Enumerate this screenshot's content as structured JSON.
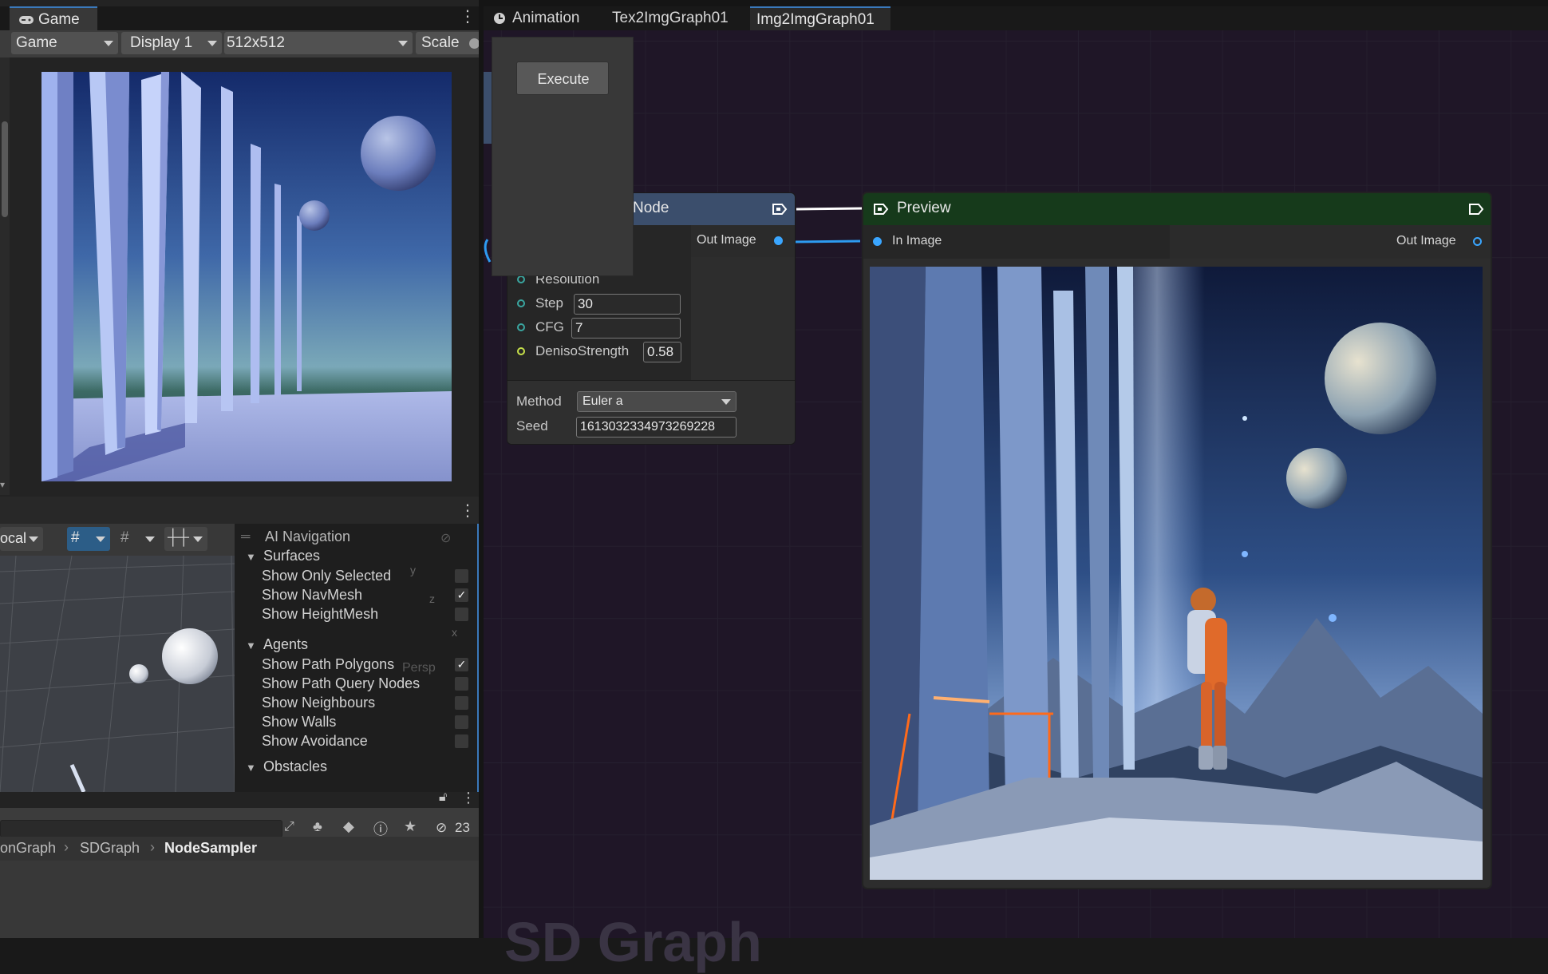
{
  "game_panel": {
    "tab_label": "Game",
    "view_select": "Game",
    "display_select": "Display 1",
    "resolution_select": "512x512",
    "scale_label": "Scale"
  },
  "editor_tabs": [
    {
      "label": "Animation"
    },
    {
      "label": "Tex2ImgGraph01"
    },
    {
      "label": "Img2ImgGraph01"
    }
  ],
  "execute_panel": {
    "execute_label": "Execute"
  },
  "sampler_node": {
    "title": "Node",
    "out_label": "Out Image",
    "fields": {
      "resolution_label": "Resolution",
      "step_label": "Step",
      "step_value": "30",
      "cfg_label": "CFG",
      "cfg_value": "7",
      "denoise_label": "DenisoStrength",
      "denoise_value": "0.58",
      "method_label": "Method",
      "method_value": "Euler a",
      "seed_label": "Seed",
      "seed_value": "1613032334973269228"
    }
  },
  "preview_node": {
    "title": "Preview",
    "in_label": "In Image",
    "out_label": "Out Image"
  },
  "scene_toolbar": {
    "pivot_select": "ocal"
  },
  "ai_navigation": {
    "title": "AI Navigation",
    "sections": [
      {
        "name": "Surfaces",
        "items": [
          {
            "label": "Show Only Selected",
            "checked": false
          },
          {
            "label": "Show NavMesh",
            "checked": true
          },
          {
            "label": "Show HeightMesh",
            "checked": false
          }
        ]
      },
      {
        "name": "Agents",
        "items": [
          {
            "label": "Show Path Polygons",
            "checked": true
          },
          {
            "label": "Show Path Query Nodes",
            "checked": false
          },
          {
            "label": "Show Neighbours",
            "checked": false
          },
          {
            "label": "Show Walls",
            "checked": false
          },
          {
            "label": "Show Avoidance",
            "checked": false
          }
        ]
      },
      {
        "name": "Obstacles",
        "items": []
      }
    ],
    "gizmo_persp": "Persp",
    "axis_y": "y",
    "axis_z": "z",
    "axis_x": "x"
  },
  "project_panel": {
    "hidden_count": "23",
    "breadcrumb": [
      "onGraph",
      "SDGraph",
      "NodeSampler"
    ]
  },
  "graph_watermark": "SD Graph",
  "colors": {
    "graph_bg": "#1f1627",
    "node_header_blue": "#3b4e6c",
    "preview_header_green": "#163a1b",
    "port_blue": "#3aa6ff",
    "accent_tab": "#3a79bb"
  }
}
